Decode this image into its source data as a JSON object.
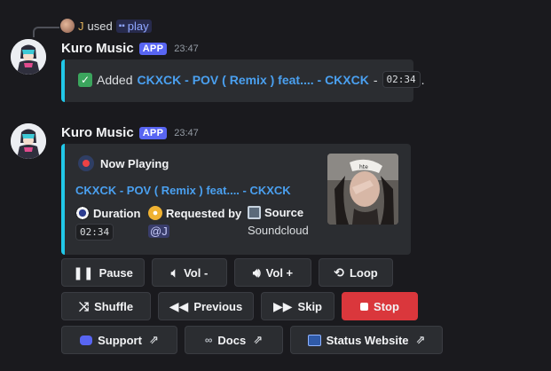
{
  "reply": {
    "user": "J",
    "used": "used",
    "command": "play"
  },
  "messages": [
    {
      "username": "Kuro Music",
      "tag": "APP",
      "time": "23:47",
      "embed": {
        "prefix": "Added",
        "song": "CKXCK - POV ( Remix ) feat.... - CKXCK",
        "separator": "-",
        "duration": "02:34",
        "suffix": "."
      }
    },
    {
      "username": "Kuro Music",
      "tag": "APP",
      "time": "23:47",
      "embed": {
        "heading": "Now Playing",
        "song": "CKXCK - POV ( Remix ) feat.... - CKXCK",
        "fields": [
          {
            "name": "Duration",
            "value": "02:34",
            "icon": "stopwatch-icon"
          },
          {
            "name": "Requested by",
            "value": "@J",
            "icon": "disc-icon"
          },
          {
            "name": "Source",
            "value": "Soundcloud",
            "icon": "floppy-icon"
          }
        ]
      }
    }
  ],
  "buttons": {
    "row1": [
      {
        "label": "Pause",
        "icon": "pause-icon"
      },
      {
        "label": "Vol -",
        "icon": "volume-down-icon"
      },
      {
        "label": "Vol +",
        "icon": "volume-up-icon"
      },
      {
        "label": "Loop",
        "icon": "loop-icon"
      }
    ],
    "row2": [
      {
        "label": "Shuffle",
        "icon": "shuffle-icon"
      },
      {
        "label": "Previous",
        "icon": "previous-icon"
      },
      {
        "label": "Skip",
        "icon": "skip-icon"
      },
      {
        "label": "Stop",
        "icon": "stop-icon"
      }
    ],
    "row3": [
      {
        "label": "Support",
        "icon": "discord-icon"
      },
      {
        "label": "Docs",
        "icon": "link-icon"
      },
      {
        "label": "Status Website",
        "icon": "website-icon"
      }
    ]
  },
  "colors": {
    "accent_bar": "#21c8e8",
    "link": "#4aa0f0",
    "app_tag": "#5865f2",
    "stop_button": "#da373c"
  }
}
